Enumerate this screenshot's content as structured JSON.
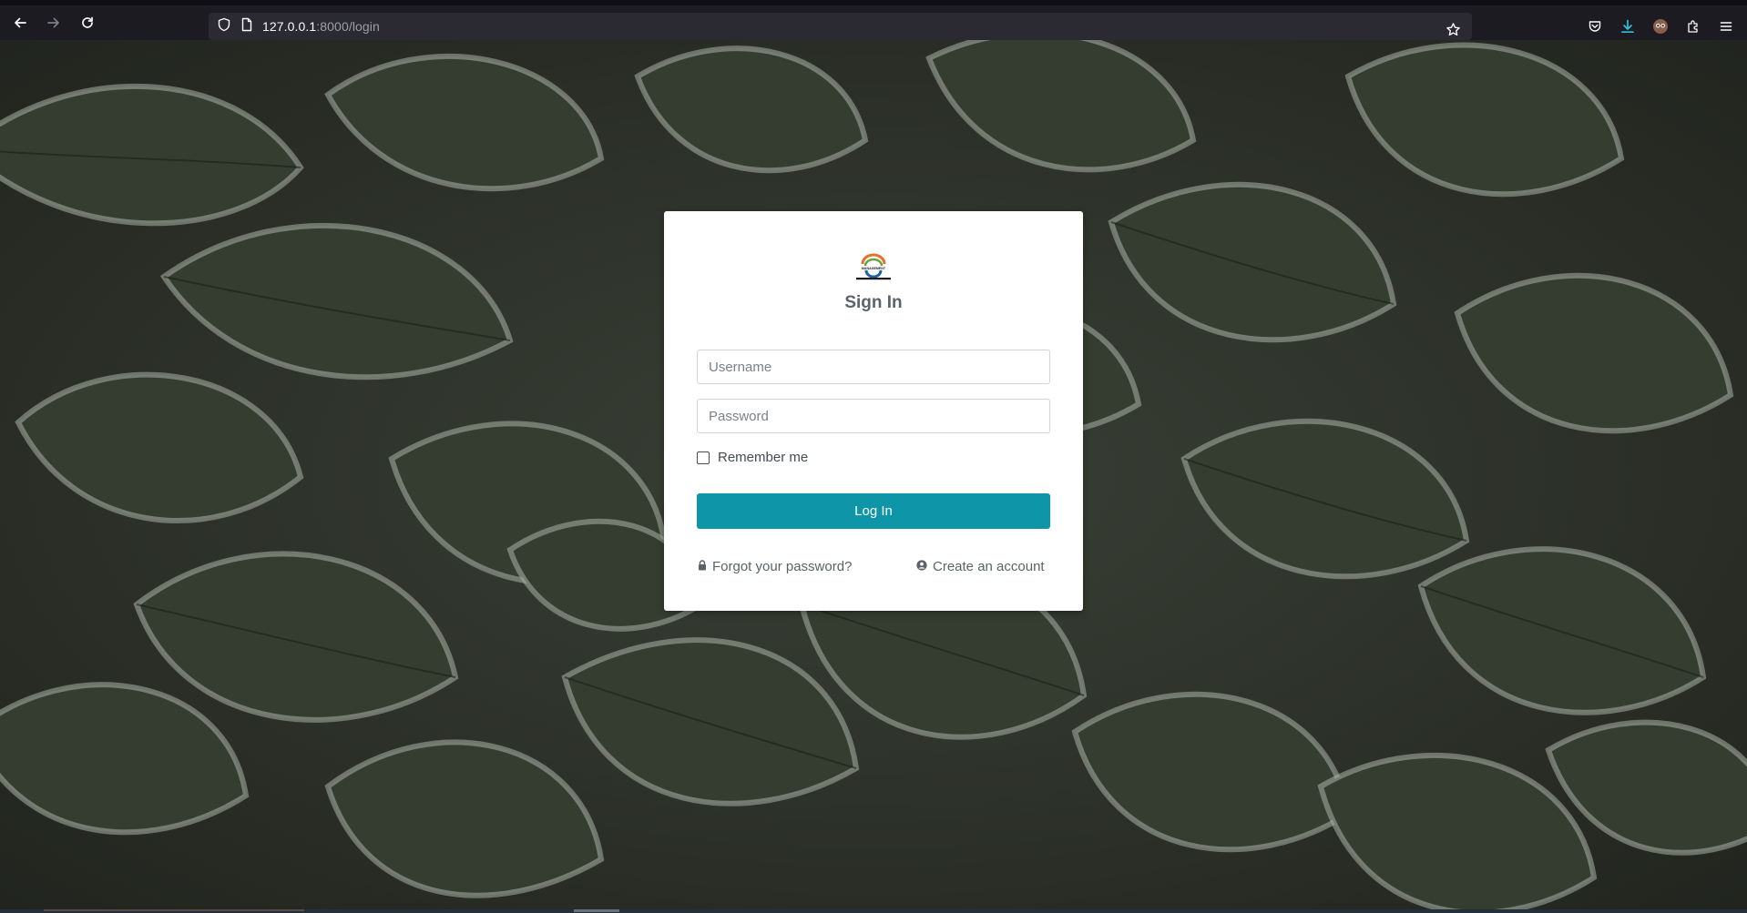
{
  "browser": {
    "url_host": "127.0.0.1",
    "url_rest": ":8000/login",
    "icons": [
      "back-arrow-icon",
      "forward-arrow-icon",
      "reload-icon",
      "shield-icon",
      "page-info-icon",
      "bookmark-star-icon",
      "pocket-icon",
      "download-icon",
      "account-avatar-icon",
      "extensions-icon",
      "menu-icon"
    ]
  },
  "login": {
    "title": "Sign In",
    "username_placeholder": "Username",
    "password_placeholder": "Password",
    "remember_label": "Remember me",
    "login_button": "Log In",
    "forgot_link": "Forgot your password?",
    "create_link": "Create an account",
    "logo_text": "MANAGEMENT"
  },
  "colors": {
    "primary_button": "#0e95a7",
    "browser_bg": "#1c1b22",
    "download_accent": "#2ac3de"
  }
}
